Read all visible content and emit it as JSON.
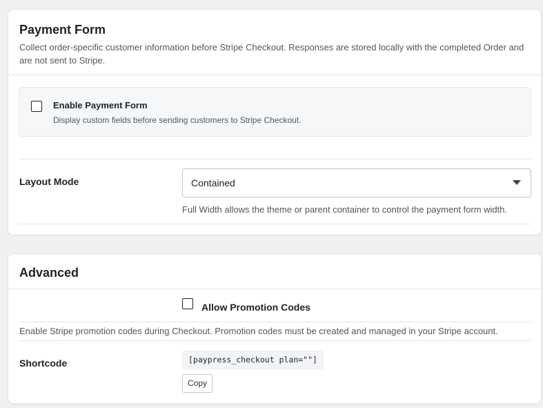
{
  "payment_form": {
    "title": "Payment Form",
    "description": "Collect order-specific customer information before Stripe Checkout. Responses are stored locally with the completed Order and are not sent to Stripe.",
    "enable": {
      "label": "Enable Payment Form",
      "sublabel": "Display custom fields before sending customers to Stripe Checkout.",
      "checked": false
    },
    "layout_mode": {
      "label": "Layout Mode",
      "value": "Contained",
      "help": "Full Width allows the theme or parent container to control the payment form width."
    }
  },
  "advanced": {
    "title": "Advanced",
    "promotion_codes": {
      "label": "Allow Promotion Codes",
      "checked": false,
      "help": "Enable Stripe promotion codes during Checkout. Promotion codes must be created and managed in your Stripe account."
    },
    "shortcode": {
      "label": "Shortcode",
      "value": "[paypress_checkout plan=\"\"]",
      "copy_label": "Copy"
    }
  }
}
